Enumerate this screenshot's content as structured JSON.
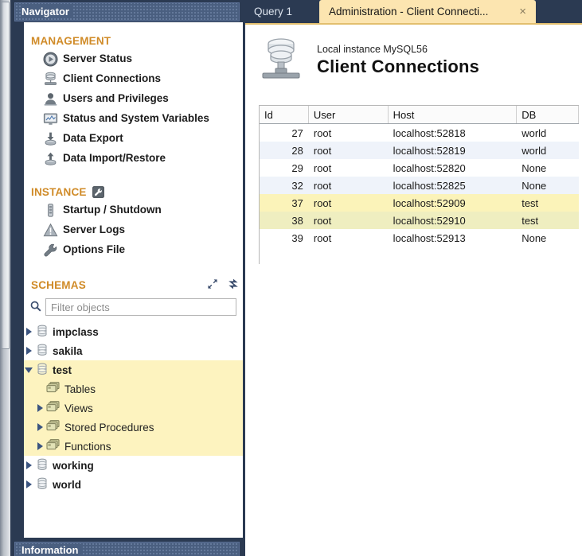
{
  "navigator": {
    "title": "Navigator",
    "management": {
      "heading": "MANAGEMENT",
      "items": [
        {
          "label": "Server Status",
          "icon": "play-circle-icon"
        },
        {
          "label": "Client Connections",
          "icon": "database-network-icon"
        },
        {
          "label": "Users and Privileges",
          "icon": "user-icon"
        },
        {
          "label": "Status and System Variables",
          "icon": "monitor-chart-icon"
        },
        {
          "label": "Data Export",
          "icon": "download-icon"
        },
        {
          "label": "Data Import/Restore",
          "icon": "upload-icon"
        }
      ]
    },
    "instance": {
      "heading": "INSTANCE",
      "heading_icon": "wrench-badge-icon",
      "items": [
        {
          "label": "Startup / Shutdown",
          "icon": "battery-icon"
        },
        {
          "label": "Server Logs",
          "icon": "warning-triangle-icon"
        },
        {
          "label": "Options File",
          "icon": "wrench-icon"
        }
      ]
    },
    "schemas": {
      "heading": "SCHEMAS",
      "tools": [
        {
          "name": "expand-collapse-icon"
        },
        {
          "name": "refresh-icon"
        }
      ],
      "filter": {
        "placeholder": "Filter objects",
        "value": "",
        "icon": "search-icon"
      },
      "tree": [
        {
          "label": "impclass",
          "expanded": false,
          "selected": false,
          "level": 0,
          "icon": "schema-icon"
        },
        {
          "label": "sakila",
          "expanded": false,
          "selected": false,
          "level": 0,
          "icon": "schema-icon"
        },
        {
          "label": "test",
          "expanded": true,
          "selected": true,
          "level": 0,
          "icon": "schema-icon"
        },
        {
          "label": "Tables",
          "expanded": null,
          "selected": true,
          "level": 1,
          "icon": "folder-icon"
        },
        {
          "label": "Views",
          "expanded": false,
          "selected": true,
          "level": 1,
          "icon": "folder-icon"
        },
        {
          "label": "Stored Procedures",
          "expanded": false,
          "selected": true,
          "level": 1,
          "icon": "folder-icon"
        },
        {
          "label": "Functions",
          "expanded": false,
          "selected": true,
          "level": 1,
          "icon": "folder-icon"
        },
        {
          "label": "working",
          "expanded": false,
          "selected": false,
          "level": 0,
          "icon": "schema-icon"
        },
        {
          "label": "world",
          "expanded": false,
          "selected": false,
          "level": 0,
          "icon": "schema-icon"
        }
      ]
    },
    "information_bar": "Information"
  },
  "tabs": [
    {
      "label": "Query 1",
      "active": false,
      "closable": false
    },
    {
      "label": "Administration - Client Connecti...",
      "active": true,
      "closable": true,
      "close_glyph": "×"
    }
  ],
  "page": {
    "icon": "mysql-instance-icon",
    "subtitle": "Local instance MySQL56",
    "title": "Client Connections"
  },
  "table": {
    "columns": [
      "Id",
      "User",
      "Host",
      "DB"
    ],
    "rows": [
      {
        "Id": "27",
        "User": "root",
        "Host": "localhost:52818",
        "DB": "world",
        "style": "rw-white"
      },
      {
        "Id": "28",
        "User": "root",
        "Host": "localhost:52819",
        "DB": "world",
        "style": "rw-alt"
      },
      {
        "Id": "29",
        "User": "root",
        "Host": "localhost:52820",
        "DB": "None",
        "style": "rw-white"
      },
      {
        "Id": "32",
        "User": "root",
        "Host": "localhost:52825",
        "DB": "None",
        "style": "rw-alt"
      },
      {
        "Id": "37",
        "User": "root",
        "Host": "localhost:52909",
        "DB": "test",
        "style": "rw-sel1"
      },
      {
        "Id": "38",
        "User": "root",
        "Host": "localhost:52910",
        "DB": "test",
        "style": "rw-sel2"
      },
      {
        "Id": "39",
        "User": "root",
        "Host": "localhost:52913",
        "DB": "None",
        "style": "rw-white"
      }
    ]
  },
  "colors": {
    "chrome": "#2b3a52",
    "panel_header": "#4a5f80",
    "section_heading": "#d08b28",
    "active_tab": "#fce5b0",
    "selection_yellow": "#fdf3bf",
    "row_alt": "#eff3fa"
  }
}
